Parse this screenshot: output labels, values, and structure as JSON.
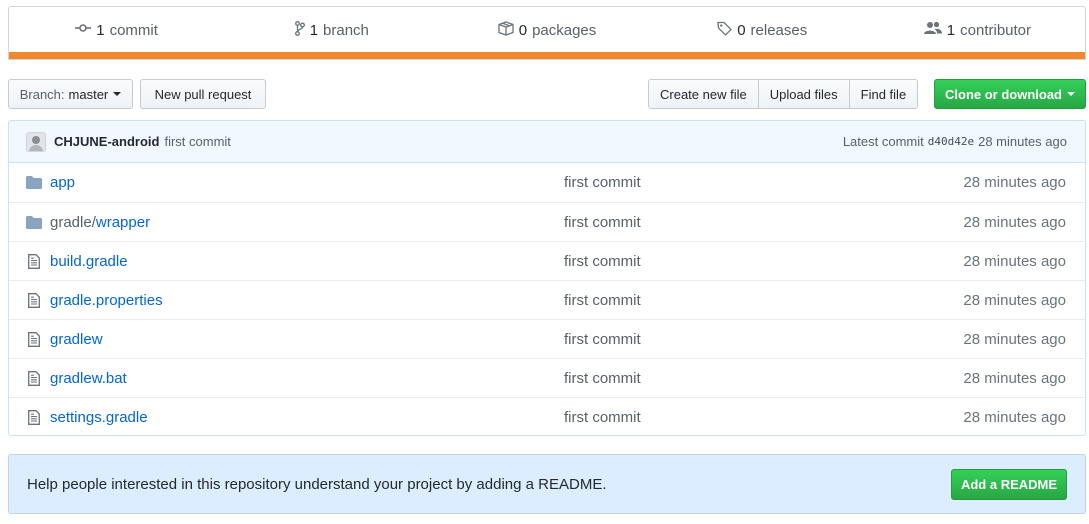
{
  "summary": {
    "commits": {
      "count": "1",
      "label": "commit",
      "icon": "commit-icon"
    },
    "branches": {
      "count": "1",
      "label": "branch",
      "icon": "branch-icon"
    },
    "packages": {
      "count": "0",
      "label": "packages",
      "icon": "package-icon"
    },
    "releases": {
      "count": "0",
      "label": "releases",
      "icon": "tag-icon"
    },
    "contributors": {
      "count": "1",
      "label": "contributor",
      "icon": "people-icon"
    },
    "language_color": "#f1882d"
  },
  "toolbar": {
    "branch_prefix": "Branch:",
    "branch_name": "master",
    "new_pull_request": "New pull request",
    "create_new_file": "Create new file",
    "upload_files": "Upload files",
    "find_file": "Find file",
    "clone_or_download": "Clone or download"
  },
  "latest_commit": {
    "author": "CHJUNE-android",
    "message": "first commit",
    "prefix": "Latest commit",
    "sha": "d40d42e",
    "age": "28 minutes ago"
  },
  "files": [
    {
      "type": "dir",
      "prefix": "",
      "name": "app",
      "commit": "first commit",
      "age": "28 minutes ago"
    },
    {
      "type": "dir",
      "prefix": "gradle/",
      "name": "wrapper",
      "commit": "first commit",
      "age": "28 minutes ago"
    },
    {
      "type": "file",
      "prefix": "",
      "name": "build.gradle",
      "commit": "first commit",
      "age": "28 minutes ago"
    },
    {
      "type": "file",
      "prefix": "",
      "name": "gradle.properties",
      "commit": "first commit",
      "age": "28 minutes ago"
    },
    {
      "type": "file",
      "prefix": "",
      "name": "gradlew",
      "commit": "first commit",
      "age": "28 minutes ago"
    },
    {
      "type": "file",
      "prefix": "",
      "name": "gradlew.bat",
      "commit": "first commit",
      "age": "28 minutes ago"
    },
    {
      "type": "file",
      "prefix": "",
      "name": "settings.gradle",
      "commit": "first commit",
      "age": "28 minutes ago"
    }
  ],
  "readme_prompt": {
    "text": "Help people interested in this repository understand your project by adding a README.",
    "button": "Add a README"
  }
}
